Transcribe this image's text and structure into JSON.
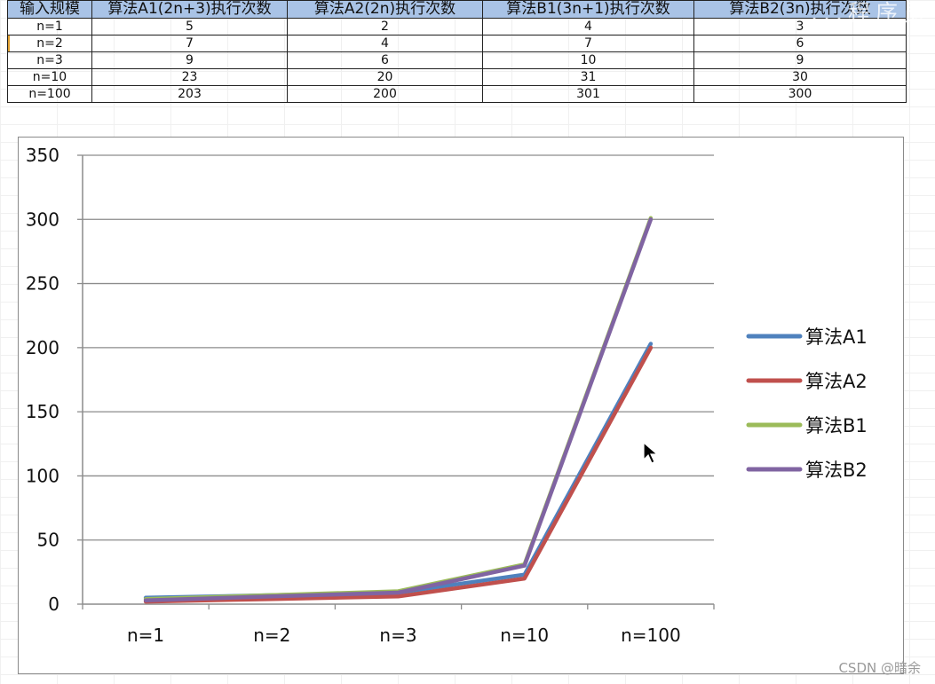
{
  "table": {
    "headers": [
      "输入规模",
      "算法A1(2n+3)执行次数",
      "算法A2(2n)执行次数",
      "算法B1(3n+1)执行次数",
      "算法B2(3n)执行次数"
    ],
    "rows": [
      [
        "n=1",
        "5",
        "2",
        "4",
        "3"
      ],
      [
        "n=2",
        "7",
        "4",
        "7",
        "6"
      ],
      [
        "n=3",
        "9",
        "6",
        "10",
        "9"
      ],
      [
        "n=10",
        "23",
        "20",
        "31",
        "30"
      ],
      [
        "n=100",
        "203",
        "200",
        "301",
        "300"
      ]
    ]
  },
  "chart_data": {
    "type": "line",
    "categories": [
      "n=1",
      "n=2",
      "n=3",
      "n=10",
      "n=100"
    ],
    "series": [
      {
        "name": "算法A1",
        "values": [
          5,
          7,
          9,
          23,
          203
        ],
        "color": "#4f81bd"
      },
      {
        "name": "算法A2",
        "values": [
          2,
          4,
          6,
          20,
          200
        ],
        "color": "#c0504d"
      },
      {
        "name": "算法B1",
        "values": [
          4,
          7,
          10,
          31,
          301
        ],
        "color": "#9bbb59"
      },
      {
        "name": "算法B2",
        "values": [
          3,
          6,
          9,
          30,
          300
        ],
        "color": "#8064a2"
      }
    ],
    "ylim": [
      0,
      350
    ],
    "yticks": [
      "0",
      "50",
      "100",
      "150",
      "200",
      "250",
      "300",
      "350"
    ],
    "grid": true,
    "legend": "right",
    "title": "",
    "xlabel": "",
    "ylabel": ""
  },
  "overlay": {
    "logo_text": "...程序员"
  },
  "watermark": "CSDN @暗余",
  "colors": {
    "header_bg": "#a9c3e6",
    "gridline": "#8c8c8c",
    "axis": "#8c8c8c"
  }
}
